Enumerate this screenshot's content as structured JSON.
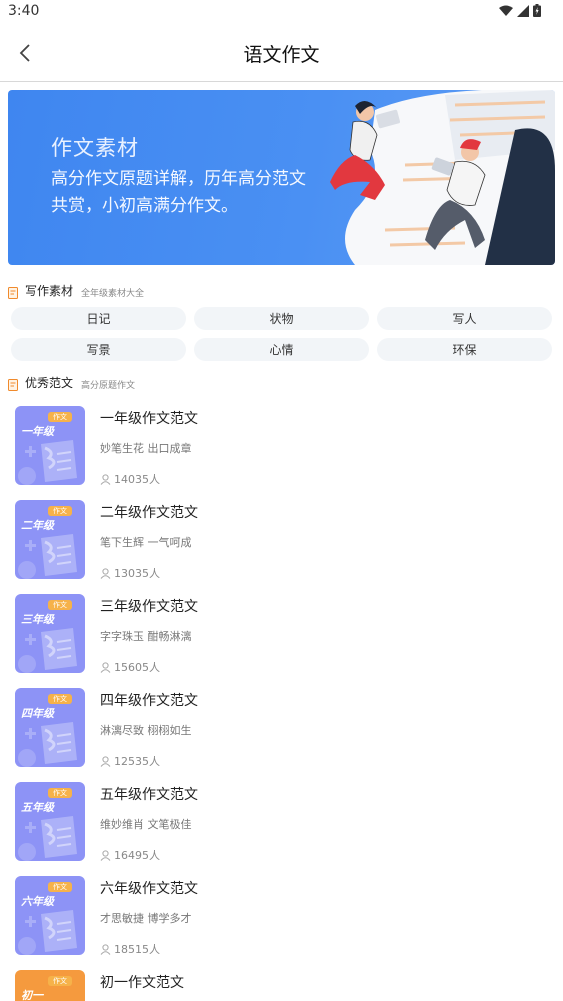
{
  "status": {
    "time": "3:40"
  },
  "header": {
    "title": "语文作文"
  },
  "banner": {
    "title": "作文素材",
    "description": "高分作文原题详解，历年高分范文共赏，小初高满分作文。"
  },
  "writing_section": {
    "title": "写作素材",
    "subtitle": "全年级素材大全",
    "chips": [
      "日记",
      "状物",
      "写人",
      "写景",
      "心情",
      "环保"
    ]
  },
  "essays_section": {
    "title": "优秀范文",
    "subtitle": "高分原题作文",
    "items": [
      {
        "grade": "一年级",
        "tag": "作文",
        "name": "一年级作文范文",
        "desc": "妙笔生花 出口成章",
        "count": "14035人",
        "color": "#8d93f6"
      },
      {
        "grade": "二年级",
        "tag": "作文",
        "name": "二年级作文范文",
        "desc": "笔下生辉 一气呵成",
        "count": "13035人",
        "color": "#8d93f6"
      },
      {
        "grade": "三年级",
        "tag": "作文",
        "name": "三年级作文范文",
        "desc": "字字珠玉 酣畅淋漓",
        "count": "15605人",
        "color": "#8d93f6"
      },
      {
        "grade": "四年级",
        "tag": "作文",
        "name": "四年级作文范文",
        "desc": "淋漓尽致 栩栩如生",
        "count": "12535人",
        "color": "#8d93f6"
      },
      {
        "grade": "五年级",
        "tag": "作文",
        "name": "五年级作文范文",
        "desc": "维妙维肖 文笔极佳",
        "count": "16495人",
        "color": "#8d93f6"
      },
      {
        "grade": "六年级",
        "tag": "作文",
        "name": "六年级作文范文",
        "desc": "才思敏捷 博学多才",
        "count": "18515人",
        "color": "#8d93f6"
      },
      {
        "grade": "初一",
        "tag": "作文",
        "name": "初一作文范文",
        "desc": "",
        "count": "",
        "color": "#f59a3e"
      }
    ]
  },
  "icons": {
    "back": "chevron-left-icon",
    "wifi": "wifi-icon",
    "signal": "signal-icon",
    "battery": "battery-icon",
    "section": "document-icon",
    "people": "person-icon"
  }
}
